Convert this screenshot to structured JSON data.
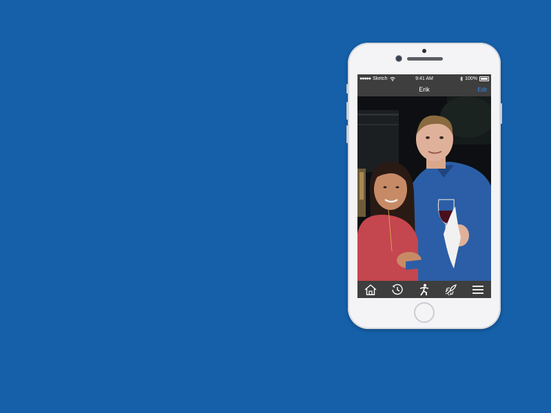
{
  "status_bar": {
    "carrier": "Sketch",
    "time": "9:41 AM",
    "battery": "100%"
  },
  "nav": {
    "title": "Erik",
    "edit_label": "Edit"
  },
  "photo": {
    "description_icon": "photo-content"
  },
  "tab_bar": {
    "icons": [
      "home-icon",
      "history-icon",
      "activity-icon",
      "rocket-icon",
      "menu-icon"
    ]
  },
  "colors": {
    "background": "#1560a9",
    "bar": "#3e3e3e",
    "accent": "#2f8cf0"
  }
}
